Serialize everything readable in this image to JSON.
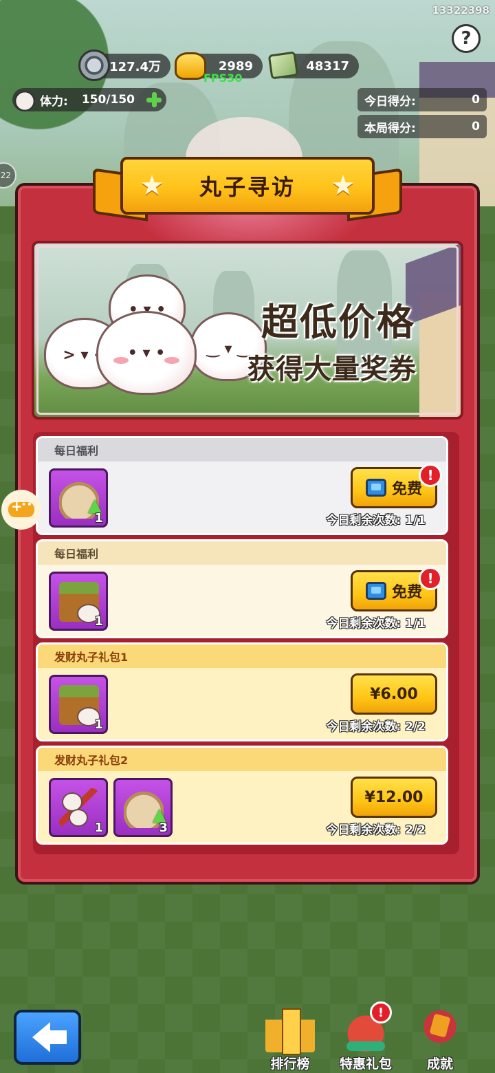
{
  "hud": {
    "user_id": "13322398",
    "help": "?",
    "coins": "127.4万",
    "gold": "2989",
    "tickets": "48317",
    "fps": "FPS30",
    "stamina_label": "体力:",
    "stamina_value": "150/150",
    "today_score_label": "今日得分:",
    "today_score": "0",
    "round_score_label": "本局得分:",
    "round_score": "0",
    "side_badge": "22"
  },
  "panel": {
    "title": "丸子寻访",
    "banner_line1": "超低价格",
    "banner_line2": "获得大量奖券"
  },
  "offers": [
    {
      "title": "每日福利",
      "button": "免费",
      "remaining": "今日剩余次数: 1/1",
      "items": [
        {
          "icon": "flour-sack-upgrade-icon",
          "count": "1"
        }
      ]
    },
    {
      "title": "每日福利",
      "button": "免费",
      "remaining": "今日剩余次数: 1/1",
      "items": [
        {
          "icon": "dumpling-box-icon",
          "count": "1"
        }
      ]
    },
    {
      "title": "发财丸子礼包1",
      "button": "¥6.00",
      "remaining": "今日剩余次数: 2/2",
      "items": [
        {
          "icon": "dumpling-box-icon",
          "count": "1"
        }
      ]
    },
    {
      "title": "发财丸子礼包2",
      "button": "¥12.00",
      "remaining": "今日剩余次数: 2/2",
      "items": [
        {
          "icon": "dumpling-skewer-icon",
          "count": "1"
        },
        {
          "icon": "flour-sack-upgrade-icon",
          "count": "3"
        }
      ]
    }
  ],
  "bottom_nav": {
    "rank": "排行榜",
    "gift": "特惠礼包",
    "achievement": "成就",
    "alert": "!"
  },
  "colors": {
    "panel_red": "#c5303f",
    "ribbon_yellow": "#ffc21a",
    "button_yellow": "#ffc515",
    "item_purple": "#9a2fc2",
    "fps_green": "#3ee04a"
  }
}
